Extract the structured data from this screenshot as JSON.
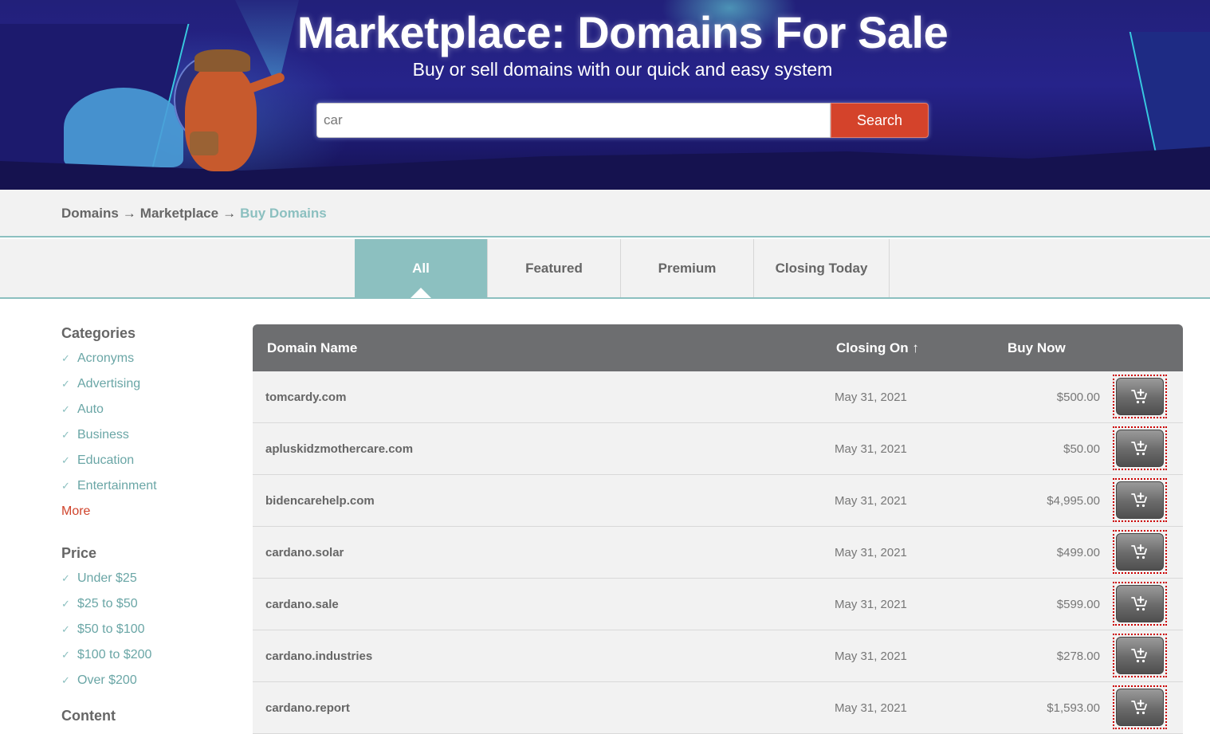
{
  "hero": {
    "title": "Marketplace: Domains For Sale",
    "subtitle": "Buy or sell domains with our quick and easy system",
    "search": {
      "value": "car",
      "button_label": "Search"
    }
  },
  "breadcrumb": {
    "items": [
      "Domains",
      "Marketplace",
      "Buy Domains"
    ],
    "separator": "→"
  },
  "tabs": [
    {
      "label": "All",
      "active": true
    },
    {
      "label": "Featured",
      "active": false
    },
    {
      "label": "Premium",
      "active": false
    },
    {
      "label": "Closing Today",
      "active": false
    }
  ],
  "sidebar": {
    "categories": {
      "title": "Categories",
      "items": [
        "Acronyms",
        "Advertising",
        "Auto",
        "Business",
        "Education",
        "Entertainment"
      ],
      "more_label": "More"
    },
    "price": {
      "title": "Price",
      "items": [
        "Under $25",
        "$25 to $50",
        "$50 to $100",
        "$100 to $200",
        "Over $200"
      ]
    },
    "content": {
      "title": "Content"
    },
    "check_icon": "✓"
  },
  "table": {
    "columns": {
      "domain_name": "Domain Name",
      "closing_on": "Closing On ↑",
      "buy_now": "Buy Now"
    },
    "rows": [
      {
        "domain": "tomcardy.com",
        "closing": "May 31, 2021",
        "price": "$500.00"
      },
      {
        "domain": "apluskidzmothercare.com",
        "closing": "May 31, 2021",
        "price": "$50.00"
      },
      {
        "domain": "bidencarehelp.com",
        "closing": "May 31, 2021",
        "price": "$4,995.00"
      },
      {
        "domain": "cardano.solar",
        "closing": "May 31, 2021",
        "price": "$499.00"
      },
      {
        "domain": "cardano.sale",
        "closing": "May 31, 2021",
        "price": "$599.00"
      },
      {
        "domain": "cardano.industries",
        "closing": "May 31, 2021",
        "price": "$278.00"
      },
      {
        "domain": "cardano.report",
        "closing": "May 31, 2021",
        "price": "$1,593.00"
      }
    ],
    "cart_icon": "add-to-cart-icon"
  },
  "colors": {
    "accent_teal": "#8cc0c0",
    "search_button": "#d4432b",
    "more_link": "#d0432b",
    "table_header": "#6d6e70",
    "hero_bg": "#26238a"
  }
}
